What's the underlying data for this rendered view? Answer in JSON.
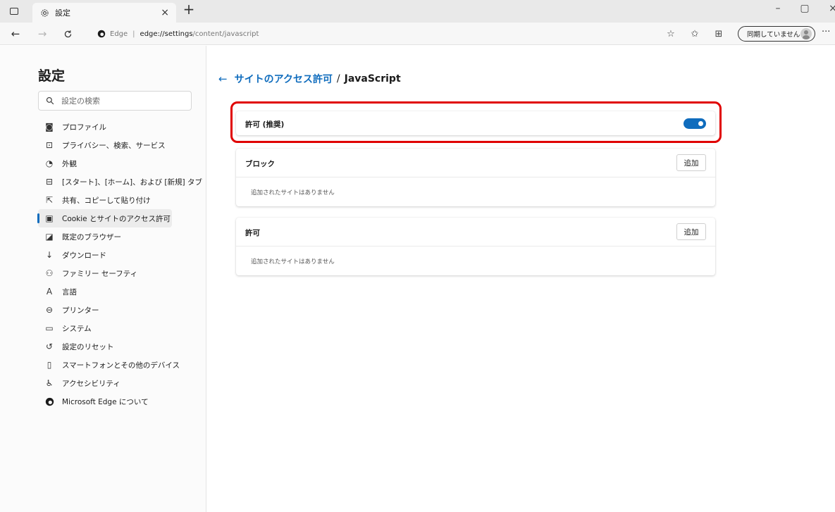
{
  "tab": {
    "title": "設定"
  },
  "toolbar": {
    "address_brand": "Edge",
    "address_host": "edge://settings",
    "address_path": "/content/javascript",
    "profile_label": "同期していません"
  },
  "sidebar": {
    "title": "設定",
    "search_placeholder": "設定の検索",
    "items": [
      {
        "label": "プロファイル",
        "icon": "profile-icon"
      },
      {
        "label": "プライバシー、検索、サービス",
        "icon": "lock-icon"
      },
      {
        "label": "外観",
        "icon": "appearance-icon"
      },
      {
        "label": "[スタート]、[ホーム]、および [新規] タブ",
        "icon": "start-home-icon"
      },
      {
        "label": "共有、コピーして貼り付け",
        "icon": "share-icon"
      },
      {
        "label": "Cookie とサイトのアクセス許可",
        "icon": "cookie-permissions-icon",
        "active": true
      },
      {
        "label": "既定のブラウザー",
        "icon": "default-browser-icon"
      },
      {
        "label": "ダウンロード",
        "icon": "download-icon"
      },
      {
        "label": "ファミリー セーフティ",
        "icon": "family-icon"
      },
      {
        "label": "言語",
        "icon": "language-icon"
      },
      {
        "label": "プリンター",
        "icon": "printer-icon"
      },
      {
        "label": "システム",
        "icon": "system-icon"
      },
      {
        "label": "設定のリセット",
        "icon": "reset-icon"
      },
      {
        "label": "スマートフォンとその他のデバイス",
        "icon": "phone-icon"
      },
      {
        "label": "アクセシビリティ",
        "icon": "accessibility-icon"
      },
      {
        "label": "Microsoft Edge について",
        "icon": "edge-logo-icon"
      }
    ]
  },
  "main": {
    "breadcrumb_parent": "サイトのアクセス許可",
    "breadcrumb_separator": "/",
    "breadcrumb_current": "JavaScript",
    "allow_toggle": {
      "label": "許可 (推奨)",
      "on": true
    },
    "block": {
      "title": "ブロック",
      "add_label": "追加",
      "empty_text": "追加されたサイトはありません"
    },
    "allow": {
      "title": "許可",
      "add_label": "追加",
      "empty_text": "追加されたサイトはありません"
    }
  },
  "colors": {
    "accent": "#0f6cbd",
    "highlight": "#e00000"
  }
}
